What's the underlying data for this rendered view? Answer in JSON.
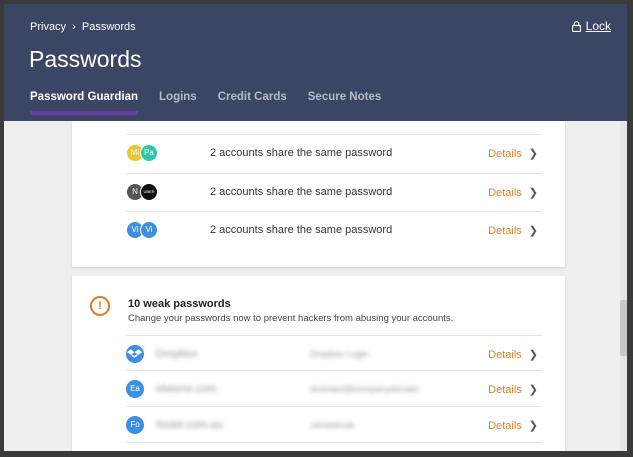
{
  "header": {
    "breadcrumb": [
      "Privacy",
      "Passwords"
    ],
    "breadcrumb_sep": "›",
    "lock_label": "Lock",
    "title": "Passwords",
    "tabs": [
      {
        "label": "Password Guardian",
        "active": true
      },
      {
        "label": "Logins",
        "active": false
      },
      {
        "label": "Credit Cards",
        "active": false
      },
      {
        "label": "Secure Notes",
        "active": false
      }
    ]
  },
  "reused": {
    "rows": [
      {
        "avatars": [
          {
            "text": "Mi",
            "color": "#e8c62f"
          },
          {
            "text": "Pa",
            "color": "#2fc7a6"
          }
        ],
        "desc": "2 accounts share the same password",
        "link": "Details"
      },
      {
        "avatars": [
          {
            "text": "N",
            "color": "#555555"
          },
          {
            "text": "UBER",
            "color": "#111111"
          }
        ],
        "desc": "2 accounts share the same password",
        "link": "Details"
      },
      {
        "avatars": [
          {
            "text": "Vi",
            "color": "#3d8fe0"
          },
          {
            "text": "Vi",
            "color": "#3d8fe0"
          }
        ],
        "desc": "2 accounts share the same password",
        "link": "Details"
      }
    ]
  },
  "weak": {
    "icon_text": "!",
    "title": "10 weak passwords",
    "subtitle": "Change your passwords now to prevent hackers from abusing your accounts.",
    "rows": [
      {
        "avatar": "",
        "site": "Dropbox",
        "user": "Dropbox Login",
        "link": "Details"
      },
      {
        "avatar": "Ea",
        "site": "ebeene.com",
        "user": "dcontact@companydomain",
        "link": "Details"
      },
      {
        "avatar": "Fo",
        "site": "footer.com.au",
        "user": "cemetenue",
        "link": "Details"
      }
    ]
  },
  "colors": {
    "header_bg": "#3a4663",
    "accent": "#6b3fa0",
    "link": "#d9822b",
    "warning": "#e07b26"
  }
}
